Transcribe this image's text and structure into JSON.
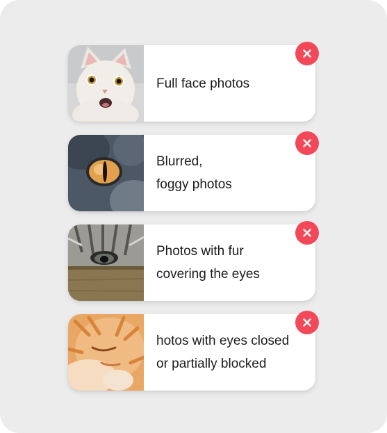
{
  "cards": [
    {
      "lines": [
        "Full face photos"
      ],
      "image": "white-kitten-face-photo",
      "icon": "close-icon"
    },
    {
      "lines": [
        "Blurred,",
        "foggy photos"
      ],
      "image": "grey-cat-eye-closeup-photo",
      "icon": "close-icon"
    },
    {
      "lines": [
        "Photos with fur",
        "covering the eyes"
      ],
      "image": "tabby-cat-peeking-over-box-photo",
      "icon": "close-icon"
    },
    {
      "lines": [
        "hotos with eyes closed",
        "or partially blocked"
      ],
      "image": "orange-cat-sleeping-photo",
      "icon": "close-icon"
    }
  ],
  "colors": {
    "background": "#ececec",
    "card": "#ffffff",
    "close_button": "#f2485a",
    "text": "#1b1b1b"
  }
}
